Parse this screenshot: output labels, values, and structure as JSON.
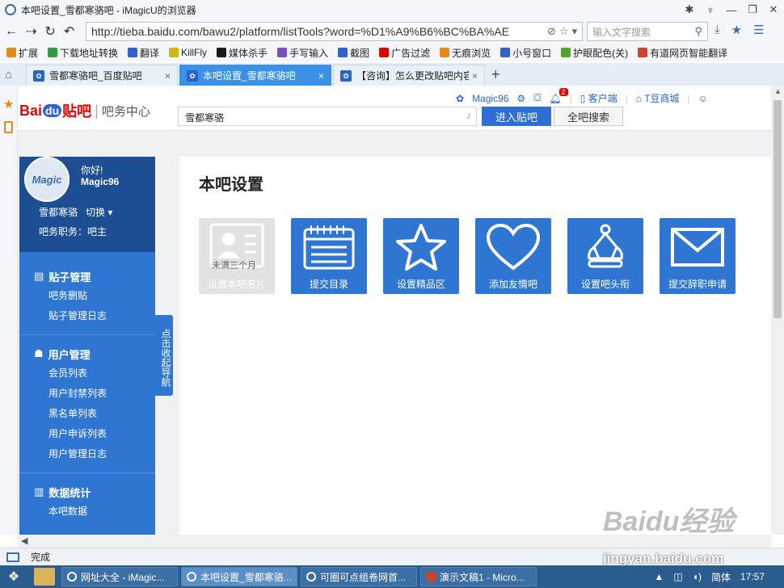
{
  "window": {
    "title": "本吧设置_雪都寒骆吧 - iMagicU的浏览器"
  },
  "nav": {
    "url": "http://tieba.baidu.com/bawu2/platform/listTools?word=%D1%A9%B6%BC%BA%AE",
    "url_domain": "tieba.baidu.com",
    "search_placeholder": "输入文字搜索"
  },
  "bookmarks": [
    {
      "label": "扩展",
      "icon": "extension-icon",
      "color": "#e38c1c"
    },
    {
      "label": "下载地址转换",
      "icon": "download-icon",
      "color": "#2e9e3a"
    },
    {
      "label": "翻译",
      "icon": "translate-icon",
      "color": "#2d63d0"
    },
    {
      "label": "KillFly",
      "icon": "killfly-icon",
      "color": "#d4b21a"
    },
    {
      "label": "媒体杀手",
      "icon": "media-killer-icon",
      "color": "#1a1a1a"
    },
    {
      "label": "手写输入",
      "icon": "pen-icon",
      "color": "#7a4fc2"
    },
    {
      "label": "截图",
      "icon": "screenshot-icon",
      "color": "#2d63d0"
    },
    {
      "label": "广告过滤",
      "icon": "ad-block-icon",
      "color": "#e10602"
    },
    {
      "label": "无痕浏览",
      "icon": "incognito-icon",
      "color": "#e38c1c"
    },
    {
      "label": "小号窗口",
      "icon": "alt-window-icon",
      "color": "#2d63d0"
    },
    {
      "label": "护眼配色(关)",
      "icon": "eye-care-icon",
      "color": "#4fa62d"
    },
    {
      "label": "有道网页智能翻译",
      "icon": "youdao-icon",
      "color": "#c9452a"
    }
  ],
  "tabs": [
    {
      "label": "雪都寒骆吧_百度贴吧",
      "active": false
    },
    {
      "label": "本吧设置_雪都寒骆吧",
      "active": true
    },
    {
      "label": "【咨询】怎么更改贴吧内容",
      "active": false
    }
  ],
  "tieba": {
    "logo_bai": "Bai",
    "logo_du": "du",
    "logo_tieba": "贴吧",
    "logo_center": "吧务中心",
    "search_value": "雪都寒骆",
    "btn_enter": "进入贴吧",
    "btn_all": "全吧搜索",
    "user": "Magic96",
    "notif_count": "2",
    "client": "客户端",
    "mall": "T豆商城"
  },
  "sidebar": {
    "avatar_text": "Magic",
    "hello": "你好!",
    "username": "Magic96",
    "forum": "雪都寒骆",
    "switch": "切换",
    "role": "吧务职务：吧主",
    "collapse": "点击收起导航",
    "sections": [
      {
        "title": "贴子管理",
        "items": [
          "吧务删贴",
          "贴子管理日志"
        ]
      },
      {
        "title": "用户管理",
        "items": [
          "会员列表",
          "用户封禁列表",
          "黑名单列表",
          "用户申诉列表",
          "用户管理日志"
        ]
      },
      {
        "title": "数据统计",
        "items": [
          "本吧数据"
        ]
      }
    ]
  },
  "main": {
    "title": "本吧设置",
    "tiles": [
      {
        "label": "设置本吧名片",
        "disabled": true,
        "stamp": "未满三个月",
        "icon": "id-card-icon"
      },
      {
        "label": "提交目录",
        "disabled": false,
        "icon": "calendar-icon"
      },
      {
        "label": "设置精品区",
        "disabled": false,
        "icon": "star-icon"
      },
      {
        "label": "添加友情吧",
        "disabled": false,
        "icon": "heart-icon"
      },
      {
        "label": "设置吧头衔",
        "disabled": false,
        "icon": "crown-icon"
      },
      {
        "label": "提交辞职申请",
        "disabled": false,
        "icon": "envelope-icon"
      }
    ]
  },
  "status": {
    "text": "完成"
  },
  "watermark": {
    "line1": "Baidu经验",
    "line2": "jingyan.baidu.com"
  },
  "taskbar": {
    "tasks": [
      {
        "label": "网址大全 - iMagic...",
        "active": false
      },
      {
        "label": "本吧设置_雪都寒骆...",
        "active": true
      },
      {
        "label": "可圈可点组卷网首...",
        "active": false
      },
      {
        "label": "演示文稿1 - Micro...",
        "active": false
      }
    ],
    "ime": "简体",
    "time": "17:57"
  },
  "colors": {
    "accent": "#2f76d3",
    "sidebar_dark": "#1d4e93",
    "tab_active": "#3a91e6",
    "brand_red": "#e10602"
  }
}
